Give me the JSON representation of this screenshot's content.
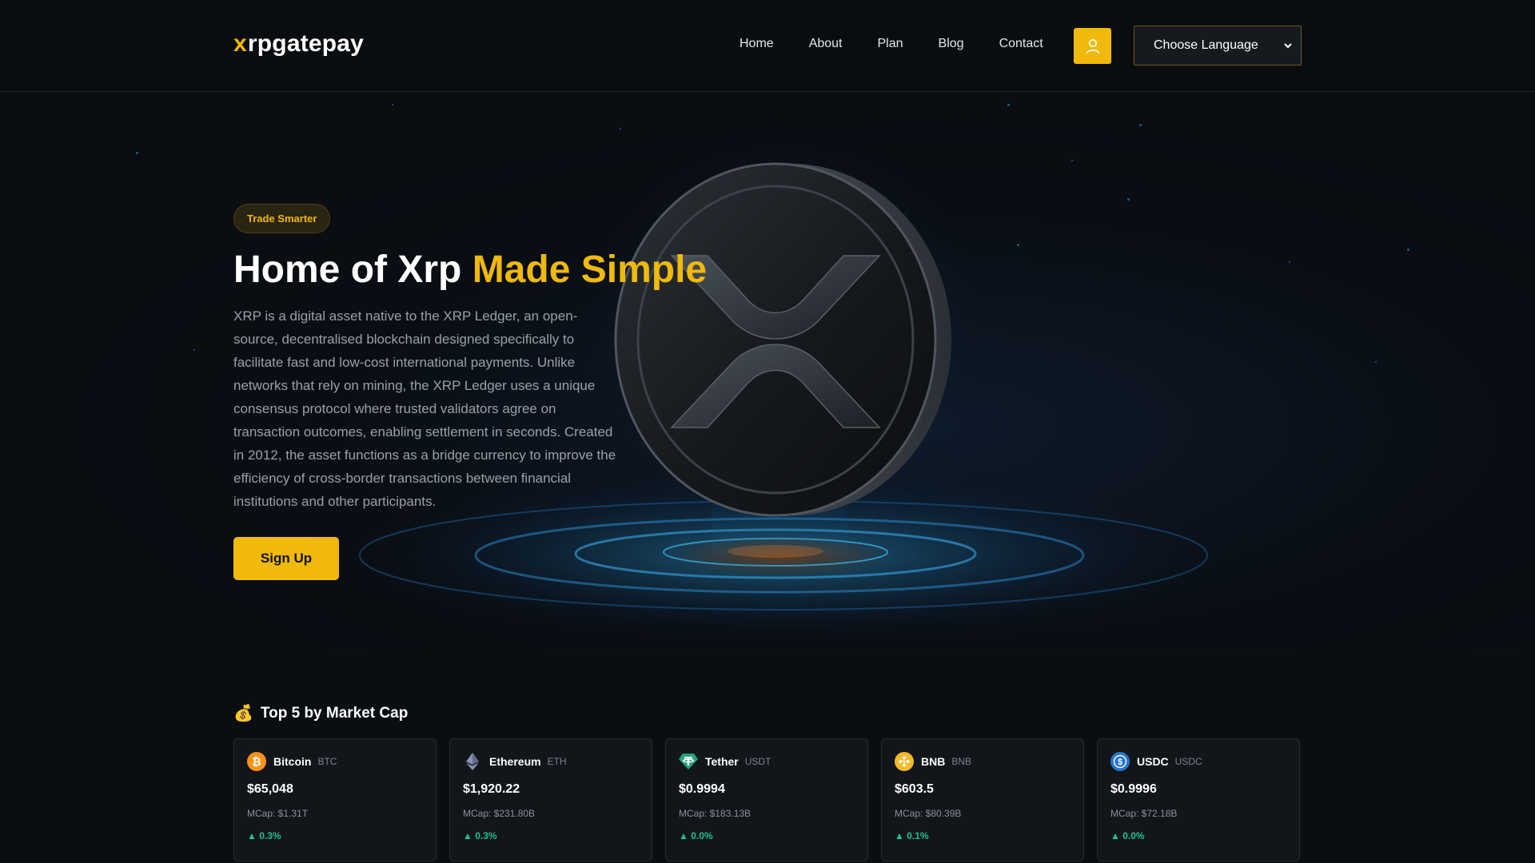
{
  "header": {
    "logo_mark": "x",
    "logo_text": "rpgatepay",
    "nav": [
      {
        "label": "Home"
      },
      {
        "label": "About"
      },
      {
        "label": "Plan"
      },
      {
        "label": "Blog"
      },
      {
        "label": "Contact"
      }
    ],
    "user_icon": "user-icon",
    "language_select": "Choose Language"
  },
  "hero": {
    "badge": "Trade Smarter",
    "title_main": "Home of Xrp ",
    "title_accent": "Made Simple",
    "description": "XRP is a digital asset native to the XRP Ledger, an open-source, decentralised blockchain designed specifically to facilitate fast and low-cost international payments. Unlike networks that rely on mining, the XRP Ledger uses a unique consensus protocol where trusted validators agree on transaction outcomes, enabling settlement in seconds. Created in 2012, the asset functions as a bridge currency to improve the efficiency of cross-border transactions between financial institutions and other participants.",
    "cta": "Sign Up"
  },
  "market": {
    "emoji": "💰",
    "title": "Top 5 by Market Cap",
    "coins": [
      {
        "name": "Bitcoin",
        "symbol": "BTC",
        "price": "$65,048",
        "mcap": "MCap: $1.31T",
        "change": "▲ 0.3%",
        "color": "#f7931a"
      },
      {
        "name": "Ethereum",
        "symbol": "ETH",
        "price": "$1,920.22",
        "mcap": "MCap: $231.80B",
        "change": "▲ 0.3%",
        "color": "#627eea"
      },
      {
        "name": "Tether",
        "symbol": "USDT",
        "price": "$0.9994",
        "mcap": "MCap: $183.13B",
        "change": "▲ 0.0%",
        "color": "#26a17b"
      },
      {
        "name": "BNB",
        "symbol": "BNB",
        "price": "$603.5",
        "mcap": "MCap: $80.39B",
        "change": "▲ 0.1%",
        "color": "#f3ba2f"
      },
      {
        "name": "USDC",
        "symbol": "USDC",
        "price": "$0.9996",
        "mcap": "MCap: $72.18B",
        "change": "▲ 0.0%",
        "color": "#2775ca"
      }
    ]
  },
  "colors": {
    "accent": "#f0b90b",
    "positive": "#1fbf8f",
    "background": "#0b0e11"
  }
}
